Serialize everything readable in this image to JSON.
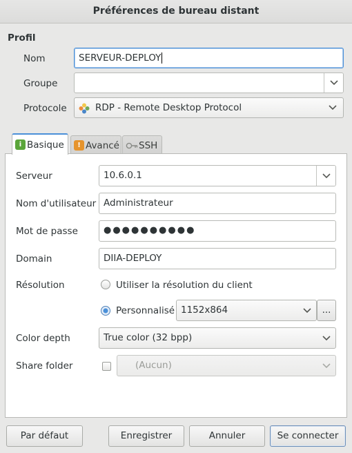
{
  "window": {
    "title": "Préférences de bureau distant"
  },
  "profile": {
    "section_label": "Profil",
    "name_label": "Nom",
    "name_value": "SERVEUR-DEPLOY",
    "group_label": "Groupe",
    "group_value": "",
    "protocol_label": "Protocole",
    "protocol_value": "RDP - Remote Desktop Protocol"
  },
  "tabs": [
    {
      "label": "Basique",
      "icon": "basic-settings-icon",
      "active": true
    },
    {
      "label": "Avancé",
      "icon": "advanced-settings-icon",
      "active": false
    },
    {
      "label": "SSH",
      "icon": "ssh-key-icon",
      "active": false
    }
  ],
  "basic": {
    "server_label": "Serveur",
    "server_value": "10.6.0.1",
    "username_label": "Nom d'utilisateur",
    "username_value": "Administrateur",
    "password_label": "Mot de passe",
    "password_value": "●●●●●●●●●●",
    "domain_label": "Domain",
    "domain_value": "DIIA-DEPLOY",
    "resolution_label": "Résolution",
    "resolution_client_label": "Utiliser la résolution du client",
    "resolution_custom_label": "Personnalisé",
    "resolution_custom_value": "1152x864",
    "resolution_more_label": "...",
    "color_depth_label": "Color depth",
    "color_depth_value": "True color (32 bpp)",
    "share_folder_label": "Share folder",
    "share_folder_value": "(Aucun)"
  },
  "buttons": {
    "default_label": "Par défaut",
    "save_label": "Enregistrer",
    "cancel_label": "Annuler",
    "connect_label": "Se connecter"
  },
  "colors": {
    "accent": "#4a90d9",
    "window_bg": "#e8e8e7",
    "page_bg": "#ffffff",
    "text": "#2e3436"
  }
}
